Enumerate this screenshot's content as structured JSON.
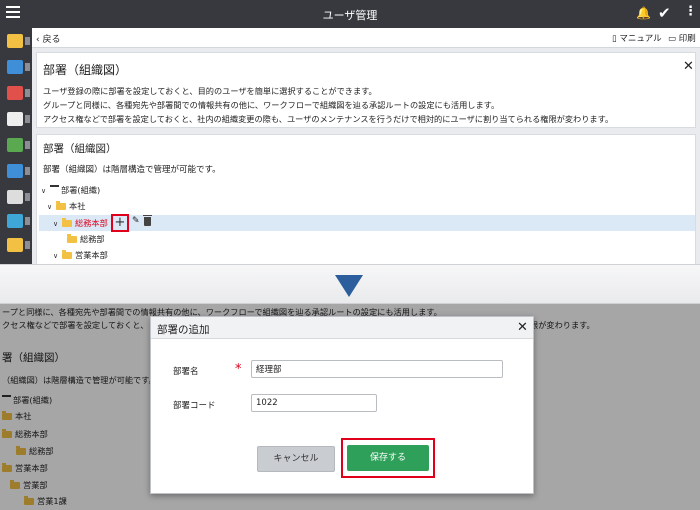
{
  "appbar": {
    "title": "ユーザ管理"
  },
  "subbar": {
    "back": "戻る",
    "manual": "マニュアル",
    "print": "印刷"
  },
  "card1": {
    "title": "部署（組織図）",
    "lines": [
      "ユーザ登録の際に部署を設定しておくと、目的のユーザを簡単に選択することができます。",
      "グループと同様に、各種宛先や部署間での情報共有の他に、ワークフローで組織図を辿る承認ルートの設定にも活用します。",
      "アクセス権などで部署を設定しておくと、社内の組織変更の際も、ユーザのメンテナンスを行うだけで相対的にユーザに割り当てられる権限が変わります。"
    ]
  },
  "card2": {
    "title": "部署（組織図）",
    "desc": "部署（組織図）は階層構造で管理が可能です。",
    "tree": {
      "root": "部署(組織)",
      "honsha": "本社",
      "soumu": "総務本部",
      "soumubu": "総務部",
      "eigyo": "営業本部"
    }
  },
  "lower": {
    "line1": "ープと同様に、各種宛先や部署間での情報共有の他に、ワークフローで組織図を辿る承認ルートの設定にも活用します。",
    "line2": "クセス権などで部署を設定しておくと、",
    "line2_tail": "限が変わります。",
    "title": "署（組織図）",
    "desc": "（組織図）は階層構造で管理が可能です。",
    "tree": [
      "部署(組織)",
      "本社",
      "総務本部",
      "総務部",
      "営業本部",
      "営業部",
      "営業1課"
    ]
  },
  "modal": {
    "title": "部署の追加",
    "name_label": "部署名",
    "required_mark": "*",
    "name_value": "経理部",
    "code_label": "部署コード",
    "code_value": "1022",
    "cancel": "キャンセル",
    "save": "保存する"
  }
}
